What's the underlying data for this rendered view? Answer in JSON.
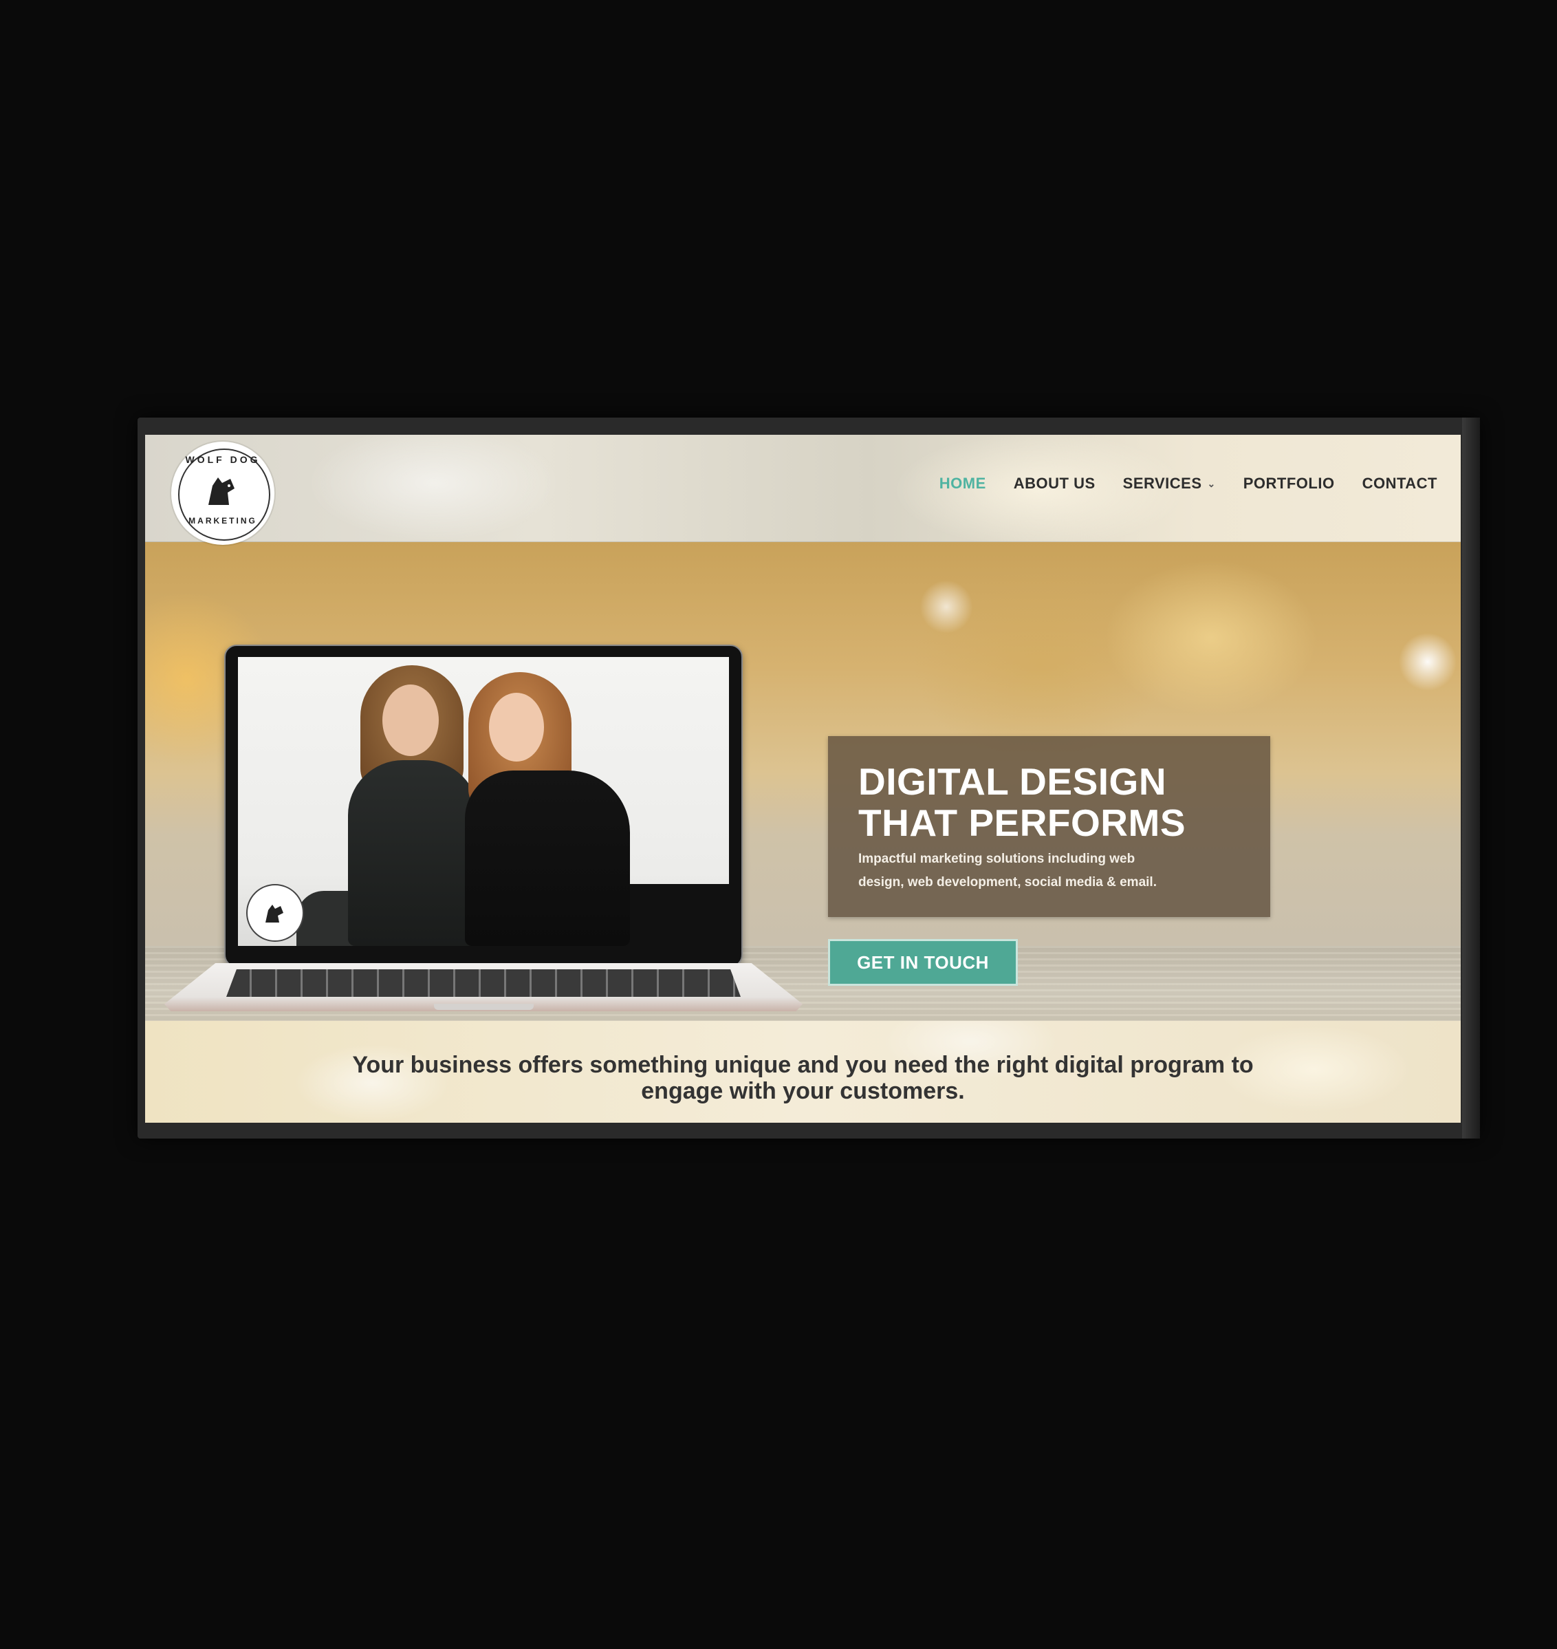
{
  "logo": {
    "top_text": "WOLF DOG",
    "bottom_text": "MARKETING",
    "icon": "wolf-dog-icon"
  },
  "nav": {
    "items": [
      {
        "label": "HOME",
        "active": true
      },
      {
        "label": "ABOUT US",
        "active": false
      },
      {
        "label": "SERVICES",
        "active": false,
        "has_dropdown": true
      },
      {
        "label": "PORTFOLIO",
        "active": false
      },
      {
        "label": "CONTACT",
        "active": false
      }
    ],
    "dropdown_icon": "chevron-down-icon"
  },
  "hero": {
    "headline_line1": "DIGITAL DESIGN",
    "headline_line2": "THAT PERFORMS",
    "subhead_line1": "Impactful marketing solutions including web",
    "subhead_line2": "design, web development, social media & email.",
    "cta_label": "GET IN TOUCH"
  },
  "intro": {
    "line1": "Your business offers something unique and you need the right digital program to",
    "line2": "engage with your customers."
  },
  "colors": {
    "accent": "#4fb3a1",
    "cta_background": "#4fa895",
    "headline_box": "#625240",
    "nav_text": "#2d2d2d"
  }
}
